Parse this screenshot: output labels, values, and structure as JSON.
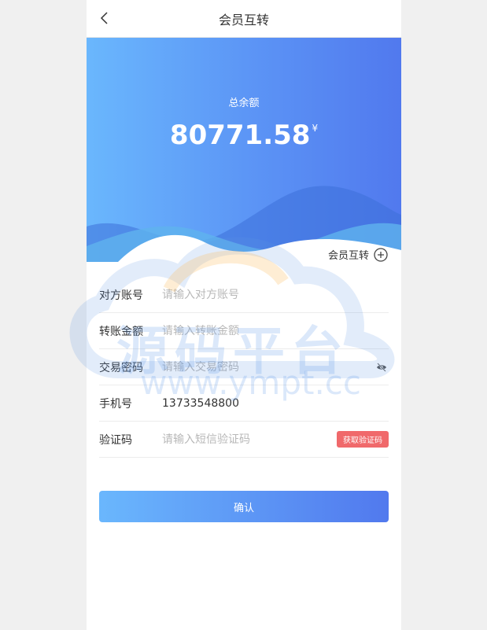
{
  "nav": {
    "title": "会员互转"
  },
  "hero": {
    "balance_label": "总余额",
    "balance": "80771.58",
    "currency": "¥"
  },
  "transfer_link": {
    "label": "会员互转"
  },
  "form": {
    "account": {
      "label": "对方账号",
      "placeholder": "请输入对方账号"
    },
    "amount": {
      "label": "转账金额",
      "placeholder": "请输入转账金额"
    },
    "password": {
      "label": "交易密码",
      "placeholder": "请输入交易密码"
    },
    "phone": {
      "label": "手机号",
      "value": "13733548800"
    },
    "code": {
      "label": "验证码",
      "placeholder": "请输入短信验证码",
      "button": "获取验证码"
    }
  },
  "confirm_label": "确认",
  "watermark": {
    "title": "源码平台",
    "url": "www.ympt.cc"
  }
}
